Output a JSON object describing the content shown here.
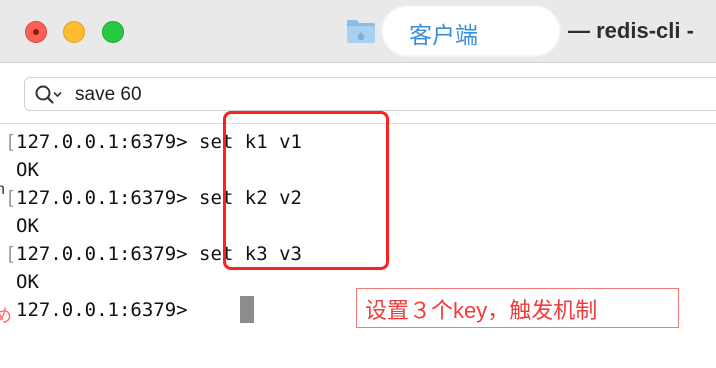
{
  "window": {
    "title_cn": "客户端",
    "title_rest": "— redis-cli -",
    "folder_color": "#8cbde6"
  },
  "search": {
    "query": "save 60"
  },
  "terminal": {
    "lines": [
      {
        "text": "127.0.0.1:6379> set k1 v1"
      },
      {
        "text": "OK"
      },
      {
        "text": "127.0.0.1:6379> set k2 v2"
      },
      {
        "text": "OK"
      },
      {
        "text": "127.0.0.1:6379> set k3 v3"
      },
      {
        "text": "OK"
      },
      {
        "text": "127.0.0.1:6379> "
      }
    ]
  },
  "annotation": {
    "text": "设置３个key，触发机制",
    "color": "#f03c3c",
    "box_color": "#ff1f1f"
  },
  "colors": {
    "close": "#fe5f57",
    "minimize": "#febc2e",
    "maximize": "#28c840",
    "title_accent": "#3a8fd9"
  },
  "edge": {
    "mark1": "h",
    "mark2": "め"
  }
}
